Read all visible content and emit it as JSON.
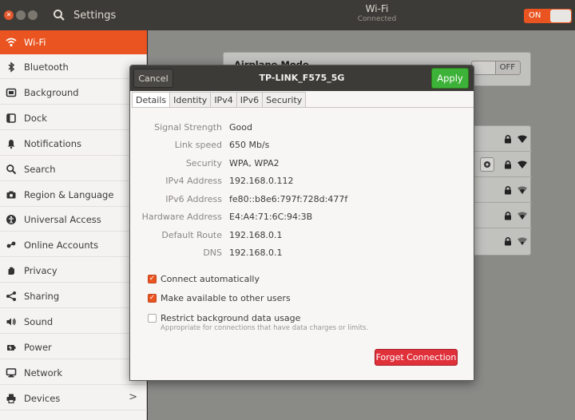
{
  "header": {
    "app_title": "Settings",
    "panel_title": "Wi-Fi",
    "panel_status": "Connected",
    "wifi_toggle_label": "ON"
  },
  "sidebar": {
    "items": [
      {
        "label": "Wi-Fi",
        "icon": "wifi-icon",
        "active": true
      },
      {
        "label": "Bluetooth",
        "icon": "bluetooth-icon"
      },
      {
        "label": "Background",
        "icon": "background-icon"
      },
      {
        "label": "Dock",
        "icon": "dock-icon"
      },
      {
        "label": "Notifications",
        "icon": "bell-icon"
      },
      {
        "label": "Search",
        "icon": "search-icon"
      },
      {
        "label": "Region & Language",
        "icon": "camera-icon"
      },
      {
        "label": "Universal Access",
        "icon": "universal-access-icon"
      },
      {
        "label": "Online Accounts",
        "icon": "online-accounts-icon"
      },
      {
        "label": "Privacy",
        "icon": "hand-icon"
      },
      {
        "label": "Sharing",
        "icon": "share-icon"
      },
      {
        "label": "Sound",
        "icon": "speaker-icon"
      },
      {
        "label": "Power",
        "icon": "power-icon"
      },
      {
        "label": "Network",
        "icon": "network-icon"
      },
      {
        "label": "Devices",
        "icon": "printer-icon",
        "has_arrow": true
      }
    ]
  },
  "main": {
    "airplane_mode_label": "Airplane Mode",
    "airplane_toggle_label": "OFF"
  },
  "dialog": {
    "cancel_label": "Cancel",
    "title": "TP-LINK_F575_5G",
    "apply_label": "Apply",
    "tabs": [
      "Details",
      "Identity",
      "IPv4",
      "IPv6",
      "Security"
    ],
    "details": [
      {
        "key": "Signal Strength",
        "value": "Good"
      },
      {
        "key": "Link speed",
        "value": "650 Mb/s"
      },
      {
        "key": "Security",
        "value": "WPA, WPA2"
      },
      {
        "key": "IPv4 Address",
        "value": "192.168.0.112"
      },
      {
        "key": "IPv6 Address",
        "value": "fe80::b8e6:797f:728d:477f"
      },
      {
        "key": "Hardware Address",
        "value": "E4:A4:71:6C:94:3B"
      },
      {
        "key": "Default Route",
        "value": "192.168.0.1"
      },
      {
        "key": "DNS",
        "value": "192.168.0.1"
      }
    ],
    "options": [
      {
        "label": "Connect automatically",
        "checked": true
      },
      {
        "label": "Make available to other users",
        "checked": true
      },
      {
        "label": "Restrict background data usage",
        "checked": false,
        "sublabel": "Appropriate for connections that have data charges or limits."
      }
    ],
    "forget_label": "Forget Connection"
  },
  "colors": {
    "accent": "#e95420",
    "apply_green": "#3db238",
    "forget_red": "#e0303a",
    "headerbar": "#3d3b38"
  }
}
